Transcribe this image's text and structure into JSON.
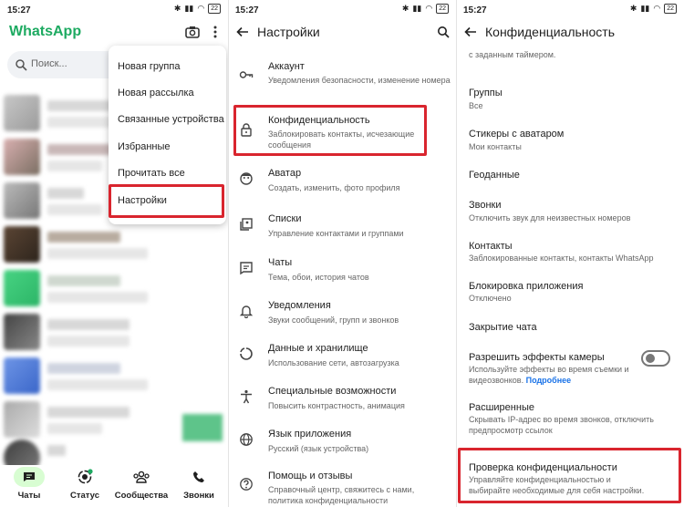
{
  "status_time": "15:27",
  "battery": "22",
  "panel1": {
    "app_title": "WhatsApp",
    "search_placeholder": "Поиск...",
    "menu": [
      "Новая группа",
      "Новая рассылка",
      "Связанные устройства",
      "Избранные",
      "Прочитать все",
      "Настройки"
    ],
    "nav": [
      "Чаты",
      "Статус",
      "Сообщества",
      "Звонки"
    ]
  },
  "panel2": {
    "title": "Настройки",
    "items": [
      {
        "title": "Аккаунт",
        "sub": "Уведомления безопасности, изменение номера"
      },
      {
        "title": "Конфиденциальность",
        "sub": "Заблокировать контакты, исчезающие сообщения"
      },
      {
        "title": "Аватар",
        "sub": "Создать, изменить, фото профиля"
      },
      {
        "title": "Списки",
        "sub": "Управление контактами и группами"
      },
      {
        "title": "Чаты",
        "sub": "Тема, обои, история чатов"
      },
      {
        "title": "Уведомления",
        "sub": "Звуки сообщений, групп и звонков"
      },
      {
        "title": "Данные и хранилище",
        "sub": "Использование сети, автозагрузка"
      },
      {
        "title": "Специальные возможности",
        "sub": "Повысить контрастность, анимация"
      },
      {
        "title": "Язык приложения",
        "sub": "Русский (язык устройства)"
      },
      {
        "title": "Помощь и отзывы",
        "sub": "Справочный центр, свяжитесь с нами, политика конфиденциальности"
      }
    ]
  },
  "panel3": {
    "title": "Конфиденциальность",
    "top_fragment": "с заданным таймером.",
    "items": [
      {
        "title": "Группы",
        "sub": "Все"
      },
      {
        "title": "Стикеры с аватаром",
        "sub": "Мои контакты"
      },
      {
        "title": "Геоданные",
        "sub": ""
      },
      {
        "title": "Звонки",
        "sub": "Отключить звук для неизвестных номеров"
      },
      {
        "title": "Контакты",
        "sub": "Заблокированные контакты, контакты WhatsApp"
      },
      {
        "title": "Блокировка приложения",
        "sub": "Отключено"
      },
      {
        "title": "Закрытие чата",
        "sub": ""
      },
      {
        "title": "Разрешить эффекты камеры",
        "sub": "Используйте эффекты во время съемки и видеозвонков."
      },
      {
        "title": "Расширенные",
        "sub": "Скрывать IP-адрес во время звонков, отключить предпросмотр ссылок"
      },
      {
        "title": "Проверка конфиденциальности",
        "sub": "Управляйте конфиденциальностью и выбирайте необходимые для себя настройки."
      }
    ],
    "camera_link": "Подробнее",
    "camera_toggle_on": false
  },
  "colors": {
    "brand": "#1daa61",
    "highlight": "#d9252e"
  }
}
